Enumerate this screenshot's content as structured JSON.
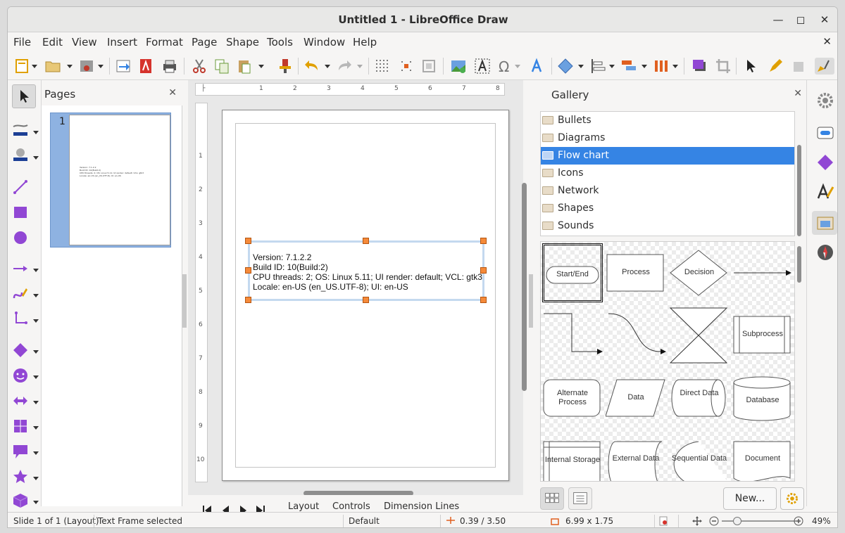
{
  "window": {
    "title": "Untitled 1 - LibreOffice Draw"
  },
  "menu": [
    "File",
    "Edit",
    "View",
    "Insert",
    "Format",
    "Page",
    "Shape",
    "Tools",
    "Window",
    "Help"
  ],
  "pages_pane": {
    "title": "Pages",
    "thumb_number": "1"
  },
  "document": {
    "text_lines": [
      "Version: 7.1.2.2",
      "Build ID: 10(Build:2)",
      "CPU threads: 2; OS: Linux 5.11; UI render: default; VCL: gtk3",
      "Locale: en-US (en_US.UTF-8); UI: en-US"
    ]
  },
  "ruler": {
    "h_ticks": [
      "1",
      "1",
      "2",
      "3",
      "4",
      "5",
      "6",
      "7",
      "8"
    ],
    "v_ticks": [
      "1",
      "1",
      "2",
      "3",
      "4",
      "5",
      "6",
      "7",
      "8",
      "9",
      "10"
    ]
  },
  "tabs": [
    "Layout",
    "Controls",
    "Dimension Lines"
  ],
  "gallery": {
    "title": "Gallery",
    "themes": [
      "Bullets",
      "Diagrams",
      "Flow chart",
      "Icons",
      "Network",
      "Shapes",
      "Sounds"
    ],
    "selected_theme": "Flow chart",
    "items": [
      "Start/End",
      "Process",
      "Decision",
      "",
      "",
      "",
      "",
      "Subprocess",
      "Alternate Process",
      "Data",
      "Direct Data",
      "Database",
      "Internal Storage",
      "External Data",
      "Sequential Data",
      "Document"
    ],
    "new_button": "New..."
  },
  "status": {
    "slide": "Slide 1 of 1 (Layout)",
    "selection": "Text Frame selected",
    "style": "Default",
    "position": "0.39 / 3.50",
    "size": "6.99 x 1.75",
    "zoom": "49%"
  },
  "colors": {
    "accent": "#3584e4",
    "handle": "#f58a3a",
    "icon_purple": "#9147d4"
  }
}
